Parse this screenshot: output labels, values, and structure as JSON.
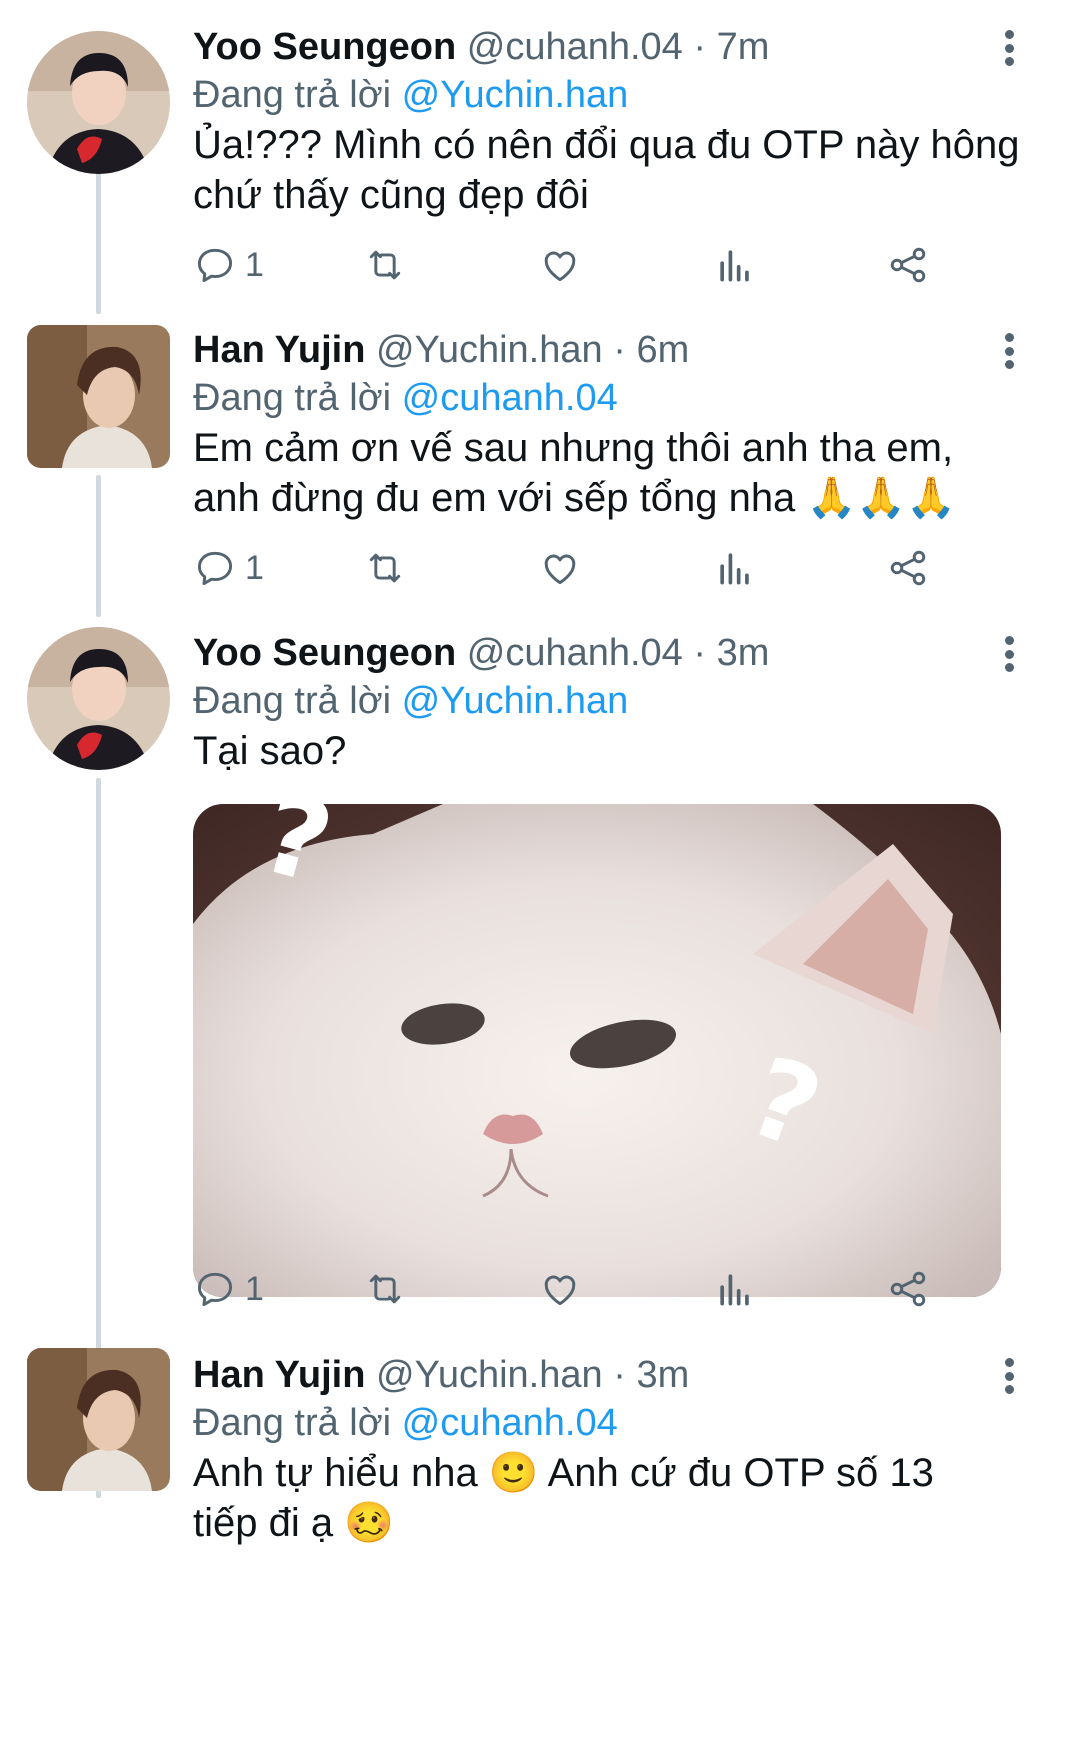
{
  "tweets": [
    {
      "name": "Yoo Seungeon",
      "handle": "@cuhanh.04",
      "time": "7m",
      "reply_prefix": "Đang trả lời",
      "reply_to": "@Yuchin.han",
      "text_line1": "Ủa!??? Mình có nên đổi qua đu OTP này hông",
      "text_line2": "chứ thấy cũng đẹp đôi",
      "reply_count": "1",
      "avatar": "yoo-seungeon-avatar"
    },
    {
      "name": "Han Yujin",
      "handle": "@Yuchin.han",
      "time": "6m",
      "reply_prefix": "Đang trả lời",
      "reply_to": "@cuhanh.04",
      "text_line1": "Em cảm ơn vế sau nhưng thôi anh tha em,",
      "text_line2": "anh đừng đu em với sếp tổng nha",
      "text_emoji2": "🙏🙏🙏",
      "reply_count": "1",
      "avatar": "han-yujin-avatar"
    },
    {
      "name": "Yoo Seungeon",
      "handle": "@cuhanh.04",
      "time": "3m",
      "reply_prefix": "Đang trả lời",
      "reply_to": "@Yuchin.han",
      "text_line1": "Tại sao?",
      "media": "confused-white-cat-image",
      "media_marks": "? ?",
      "reply_count": "1",
      "avatar": "yoo-seungeon-avatar"
    },
    {
      "name": "Han Yujin",
      "handle": "@Yuchin.han",
      "time": "3m",
      "reply_prefix": "Đang trả lời",
      "reply_to": "@cuhanh.04",
      "text_line1a": "Anh tự hiểu nha",
      "text_emoji1": "🙂",
      "text_line1b": "Anh cứ đu OTP số 13",
      "text_line2": "tiếp đi ạ",
      "text_emoji2": "🥴",
      "avatar": "han-yujin-avatar"
    }
  ],
  "separator": "·",
  "icons": [
    "reply-icon",
    "retweet-icon",
    "like-icon",
    "analytics-icon",
    "share-icon",
    "more-icon"
  ],
  "colors": {
    "link": "#1d9bf0",
    "muted": "#536471",
    "text": "#0f1419",
    "thread": "#cfd9de"
  }
}
